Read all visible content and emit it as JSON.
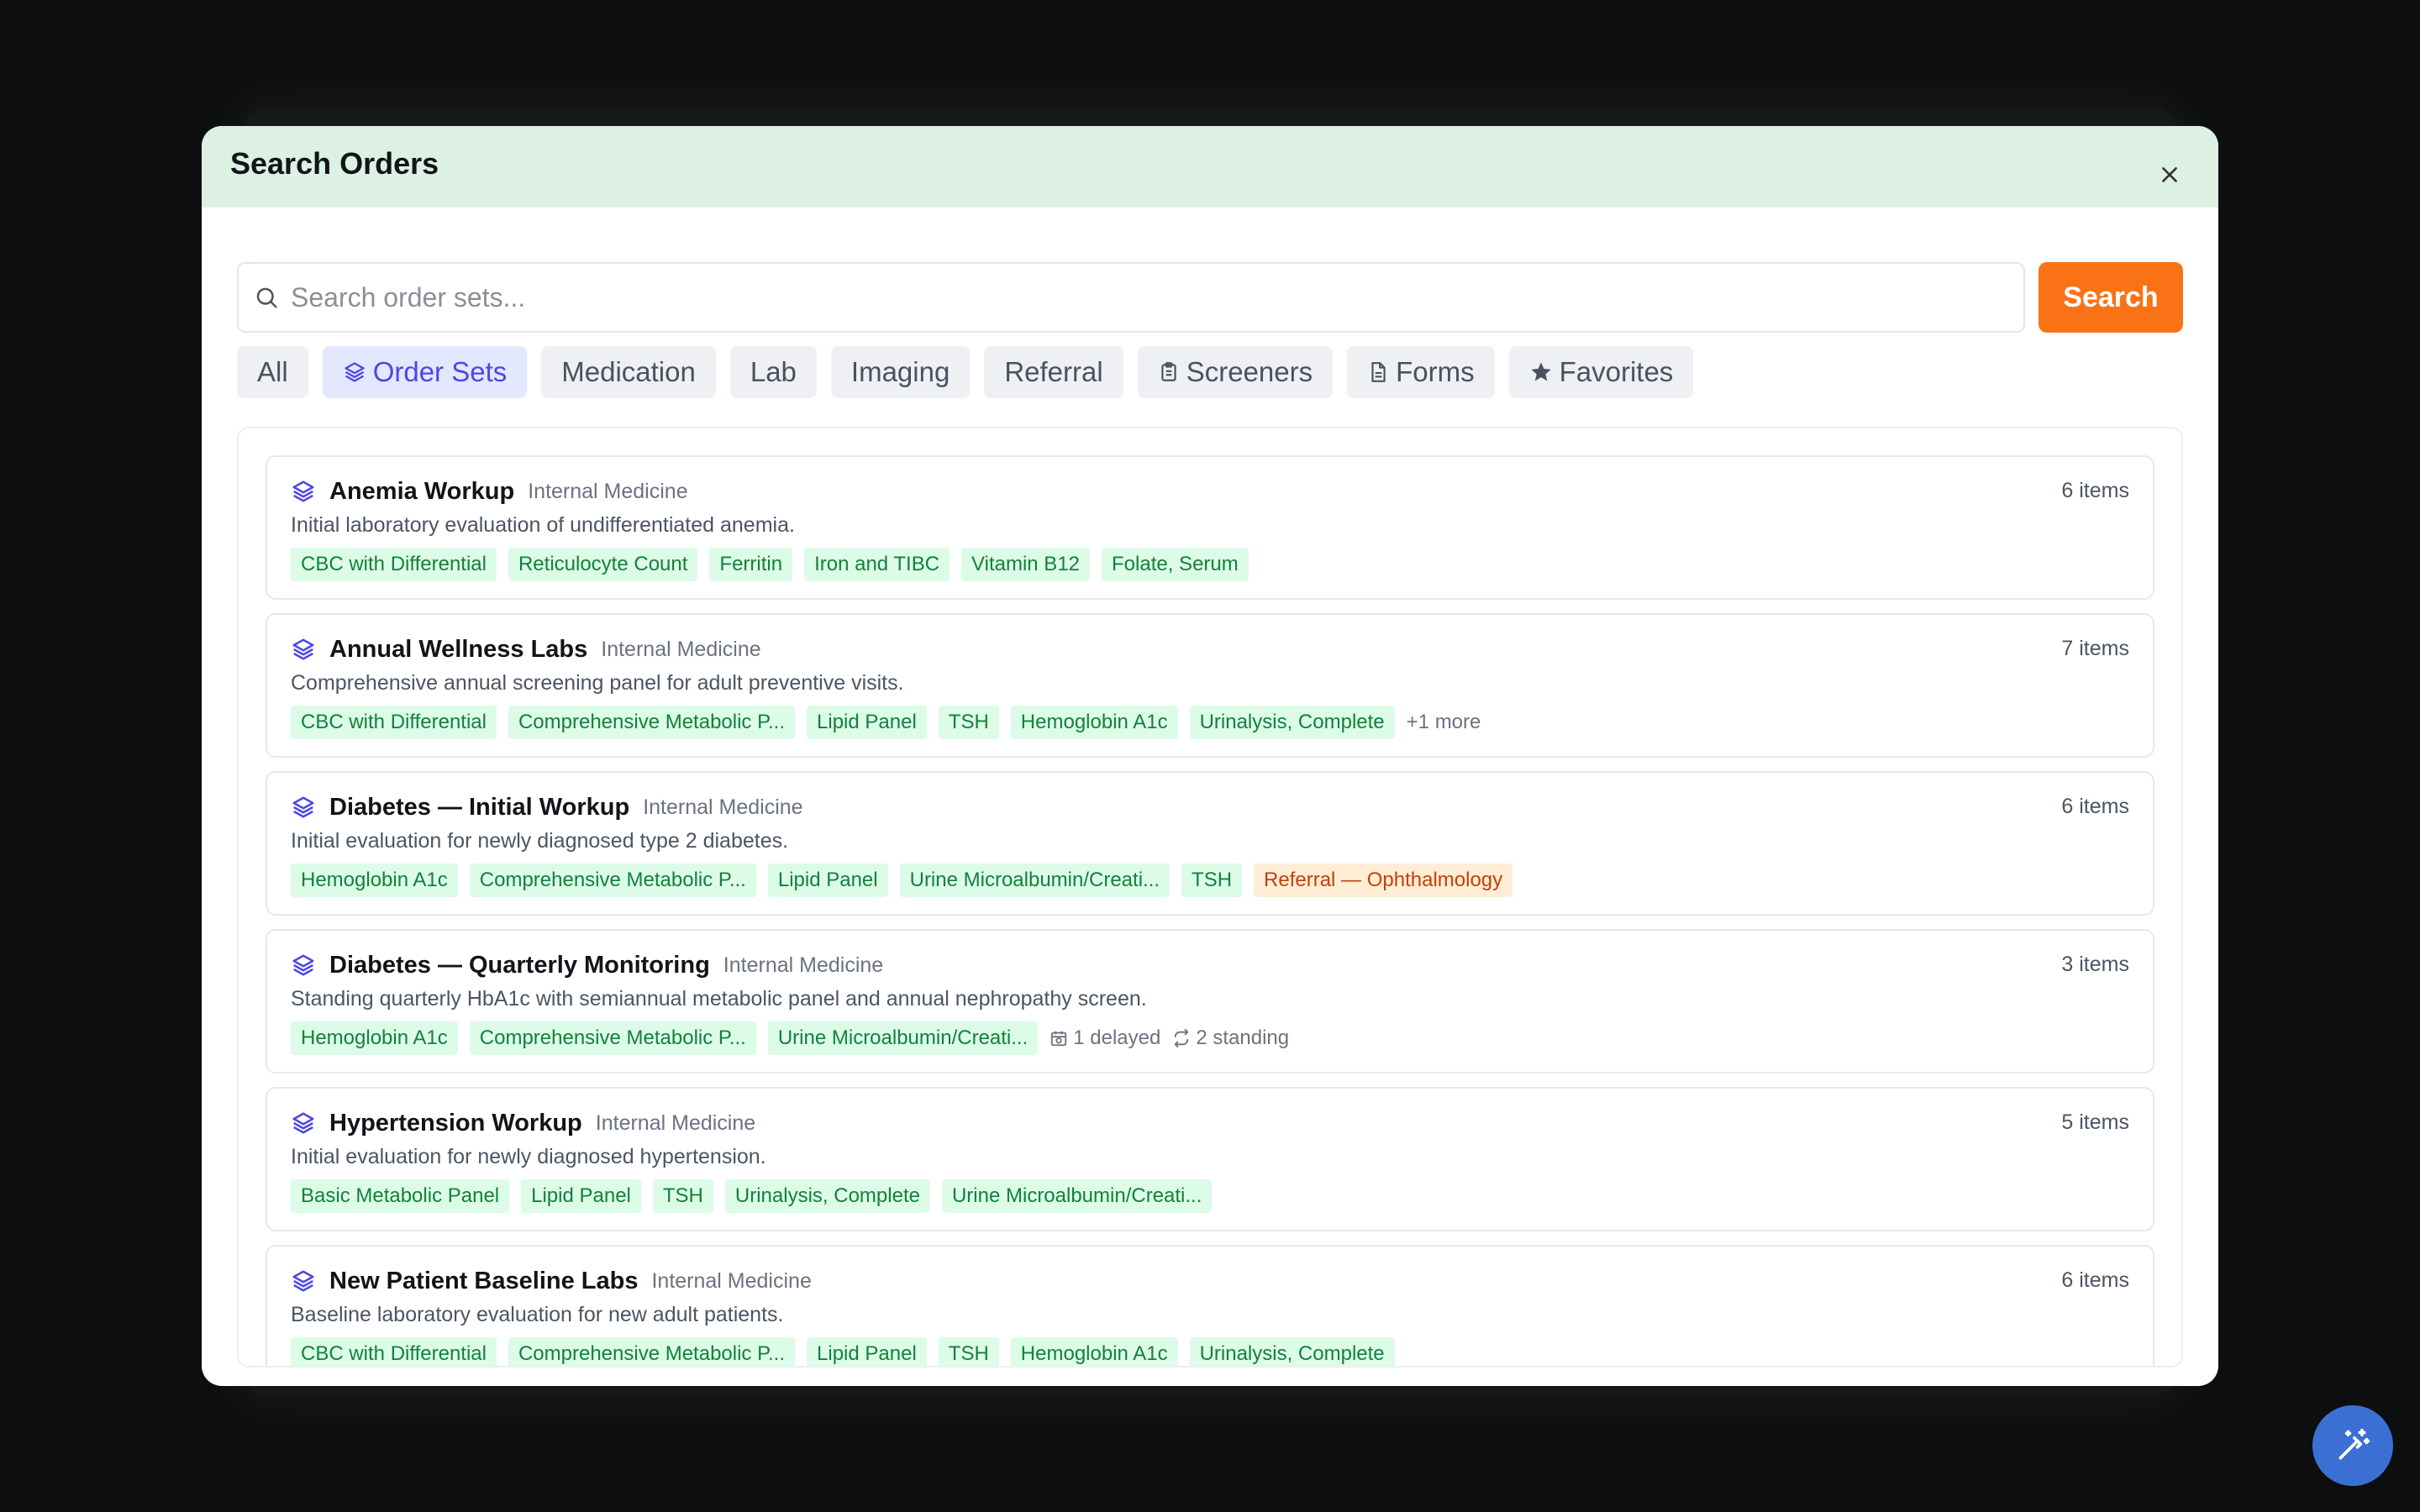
{
  "modal": {
    "title": "Search Orders",
    "close_icon": "close-icon"
  },
  "search": {
    "placeholder": "Search order sets...",
    "value": "",
    "button_label": "Search"
  },
  "tabs": [
    {
      "label": "All",
      "icon": null,
      "active": false
    },
    {
      "label": "Order Sets",
      "icon": "layers-icon",
      "active": true
    },
    {
      "label": "Medication",
      "icon": null,
      "active": false
    },
    {
      "label": "Lab",
      "icon": null,
      "active": false
    },
    {
      "label": "Imaging",
      "icon": null,
      "active": false
    },
    {
      "label": "Referral",
      "icon": null,
      "active": false
    },
    {
      "label": "Screeners",
      "icon": "clipboard-icon",
      "active": false
    },
    {
      "label": "Forms",
      "icon": "document-icon",
      "active": false
    },
    {
      "label": "Favorites",
      "icon": "star-icon",
      "active": false
    }
  ],
  "order_sets": [
    {
      "name": "Anemia Workup",
      "department": "Internal Medicine",
      "description": "Initial laboratory evaluation of undifferentiated anemia.",
      "count": "6 items",
      "chips": [
        "CBC with Differential",
        "Reticulocyte Count",
        "Ferritin",
        "Iron and TIBC",
        "Vitamin B12",
        "Folate, Serum"
      ],
      "referral_chips": [],
      "more": "",
      "delayed": "",
      "standing": ""
    },
    {
      "name": "Annual Wellness Labs",
      "department": "Internal Medicine",
      "description": "Comprehensive annual screening panel for adult preventive visits.",
      "count": "7 items",
      "chips": [
        "CBC with Differential",
        "Comprehensive Metabolic P...",
        "Lipid Panel",
        "TSH",
        "Hemoglobin A1c",
        "Urinalysis, Complete"
      ],
      "referral_chips": [],
      "more": "+1 more",
      "delayed": "",
      "standing": ""
    },
    {
      "name": "Diabetes — Initial Workup",
      "department": "Internal Medicine",
      "description": "Initial evaluation for newly diagnosed type 2 diabetes.",
      "count": "6 items",
      "chips": [
        "Hemoglobin A1c",
        "Comprehensive Metabolic P...",
        "Lipid Panel",
        "Urine Microalbumin/Creati...",
        "TSH"
      ],
      "referral_chips": [
        "Referral — Ophthalmology"
      ],
      "more": "",
      "delayed": "",
      "standing": ""
    },
    {
      "name": "Diabetes — Quarterly Monitoring",
      "department": "Internal Medicine",
      "description": "Standing quarterly HbA1c with semiannual metabolic panel and annual nephropathy screen.",
      "count": "3 items",
      "chips": [
        "Hemoglobin A1c",
        "Comprehensive Metabolic P...",
        "Urine Microalbumin/Creati..."
      ],
      "referral_chips": [],
      "more": "",
      "delayed": "1 delayed",
      "standing": "2 standing"
    },
    {
      "name": "Hypertension Workup",
      "department": "Internal Medicine",
      "description": "Initial evaluation for newly diagnosed hypertension.",
      "count": "5 items",
      "chips": [
        "Basic Metabolic Panel",
        "Lipid Panel",
        "TSH",
        "Urinalysis, Complete",
        "Urine Microalbumin/Creati..."
      ],
      "referral_chips": [],
      "more": "",
      "delayed": "",
      "standing": ""
    },
    {
      "name": "New Patient Baseline Labs",
      "department": "Internal Medicine",
      "description": "Baseline laboratory evaluation for new adult patients.",
      "count": "6 items",
      "chips": [
        "CBC with Differential",
        "Comprehensive Metabolic P...",
        "Lipid Panel",
        "TSH",
        "Hemoglobin A1c",
        "Urinalysis, Complete"
      ],
      "referral_chips": [],
      "more": "",
      "delayed": "",
      "standing": ""
    }
  ],
  "fab": {
    "icon": "magic-wand-icon"
  },
  "colors": {
    "header_bg": "#dcf0e4",
    "accent_orange": "#f97316",
    "active_tab": "#4f46e5",
    "chip_green_bg": "#dcfce7",
    "chip_green_text": "#15803d",
    "chip_orange_bg": "#ffedd5",
    "chip_orange_text": "#c2410c",
    "fab_blue": "#3b6fd4"
  }
}
